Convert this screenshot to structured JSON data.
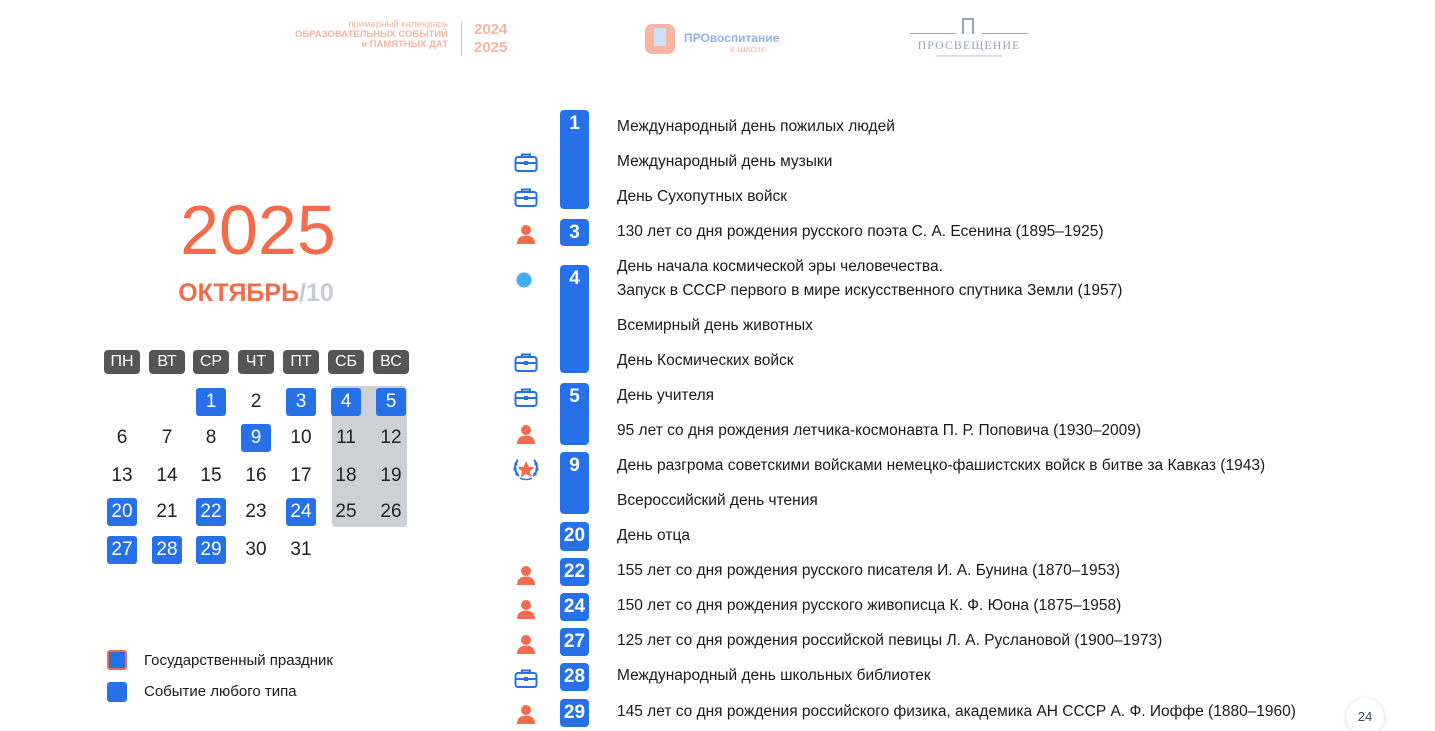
{
  "header": {
    "calendar_line1": "примерный календарь",
    "calendar_line2": "ОБРАЗОВАТЕЛЬНЫХ СОБЫТИЙ",
    "calendar_line3": "и ПАМЯТНЫХ ДАТ",
    "year1": "2024",
    "year2": "2025",
    "pro_title": "ПРОвоспитание",
    "pro_subtitle": "в школе",
    "prosv_title": "ПРОСВЕЩЕНИЕ"
  },
  "left": {
    "year": "2025",
    "month_name": "ОКТЯБРЬ",
    "month_num": "/10"
  },
  "calendar": {
    "weekdays": [
      "ПН",
      "ВТ",
      "СР",
      "ЧТ",
      "ПТ",
      "СБ",
      "ВС"
    ],
    "days": [
      {
        "n": "1",
        "ev": true
      },
      {
        "n": "2",
        "ev": false
      },
      {
        "n": "3",
        "ev": true
      },
      {
        "n": "4",
        "ev": true
      },
      {
        "n": "5",
        "ev": true
      },
      {
        "n": "6",
        "ev": false
      },
      {
        "n": "7",
        "ev": false
      },
      {
        "n": "8",
        "ev": false
      },
      {
        "n": "9",
        "ev": true
      },
      {
        "n": "10",
        "ev": false
      },
      {
        "n": "11",
        "ev": false
      },
      {
        "n": "12",
        "ev": false
      },
      {
        "n": "13",
        "ev": false
      },
      {
        "n": "14",
        "ev": false
      },
      {
        "n": "15",
        "ev": false
      },
      {
        "n": "16",
        "ev": false
      },
      {
        "n": "17",
        "ev": false
      },
      {
        "n": "18",
        "ev": false
      },
      {
        "n": "19",
        "ev": false
      },
      {
        "n": "20",
        "ev": true
      },
      {
        "n": "21",
        "ev": false
      },
      {
        "n": "22",
        "ev": true
      },
      {
        "n": "23",
        "ev": false
      },
      {
        "n": "24",
        "ev": true
      },
      {
        "n": "25",
        "ev": false
      },
      {
        "n": "26",
        "ev": false
      },
      {
        "n": "27",
        "ev": true
      },
      {
        "n": "28",
        "ev": true
      },
      {
        "n": "29",
        "ev": true
      },
      {
        "n": "30",
        "ev": false
      },
      {
        "n": "31",
        "ev": false
      }
    ]
  },
  "legend": {
    "state_holiday": "Государственный праздник",
    "any_event": "Событие любого типа"
  },
  "events": {
    "d1": "1",
    "d3": "3",
    "d4": "4",
    "d5": "5",
    "d9": "9",
    "d20": "20",
    "d22": "22",
    "d24": "24",
    "d27": "27",
    "d28": "28",
    "d29": "29",
    "e01": "Международный день пожилых людей",
    "e02": "Международный день музыки",
    "e03": "День Сухопутных войск",
    "e04": "130 лет со дня рождения русского поэта С. А. Есенина (1895–1925)",
    "e05a": "День начала космической эры человечества.",
    "e05b": "Запуск в СССР первого в мире искусственного спутника Земли (1957)",
    "e06": "Всемирный день животных",
    "e07": "День Космических войск",
    "e08": "День учителя",
    "e09": "95 лет со дня рождения летчика-космонавта П. Р. Поповича (1930–2009)",
    "e10": "День разгрома советскими войсками немецко-фашистских войск в битве за Кавказ (1943)",
    "e11": "Всероссийский день чтения",
    "e12": "День отца",
    "e13": "155 лет со дня рождения русского писателя И. А. Бунина (1870–1953)",
    "e14": "150 лет со дня рождения русского живописца К. Ф. Юона (1875–1958)",
    "e15": "125 лет со дня рождения российской певицы Л. А. Руслановой (1900–1973)",
    "e16": "Международный день школьных библиотек",
    "e17": "145 лет со дня рождения российского физика, академика АН СССР А. Ф. Иоффе (1880–1960)"
  },
  "icons": {
    "briefcase": "briefcase-icon",
    "person": "person-icon",
    "dot": "space-dot-icon",
    "laurel": "laurel-star-icon"
  },
  "colors": {
    "accent_orange": "#f26b4a",
    "event_blue": "#2670e8",
    "weekday_gray": "#555555",
    "weekend_bg": "#cdd0d6"
  },
  "page_number": "24"
}
